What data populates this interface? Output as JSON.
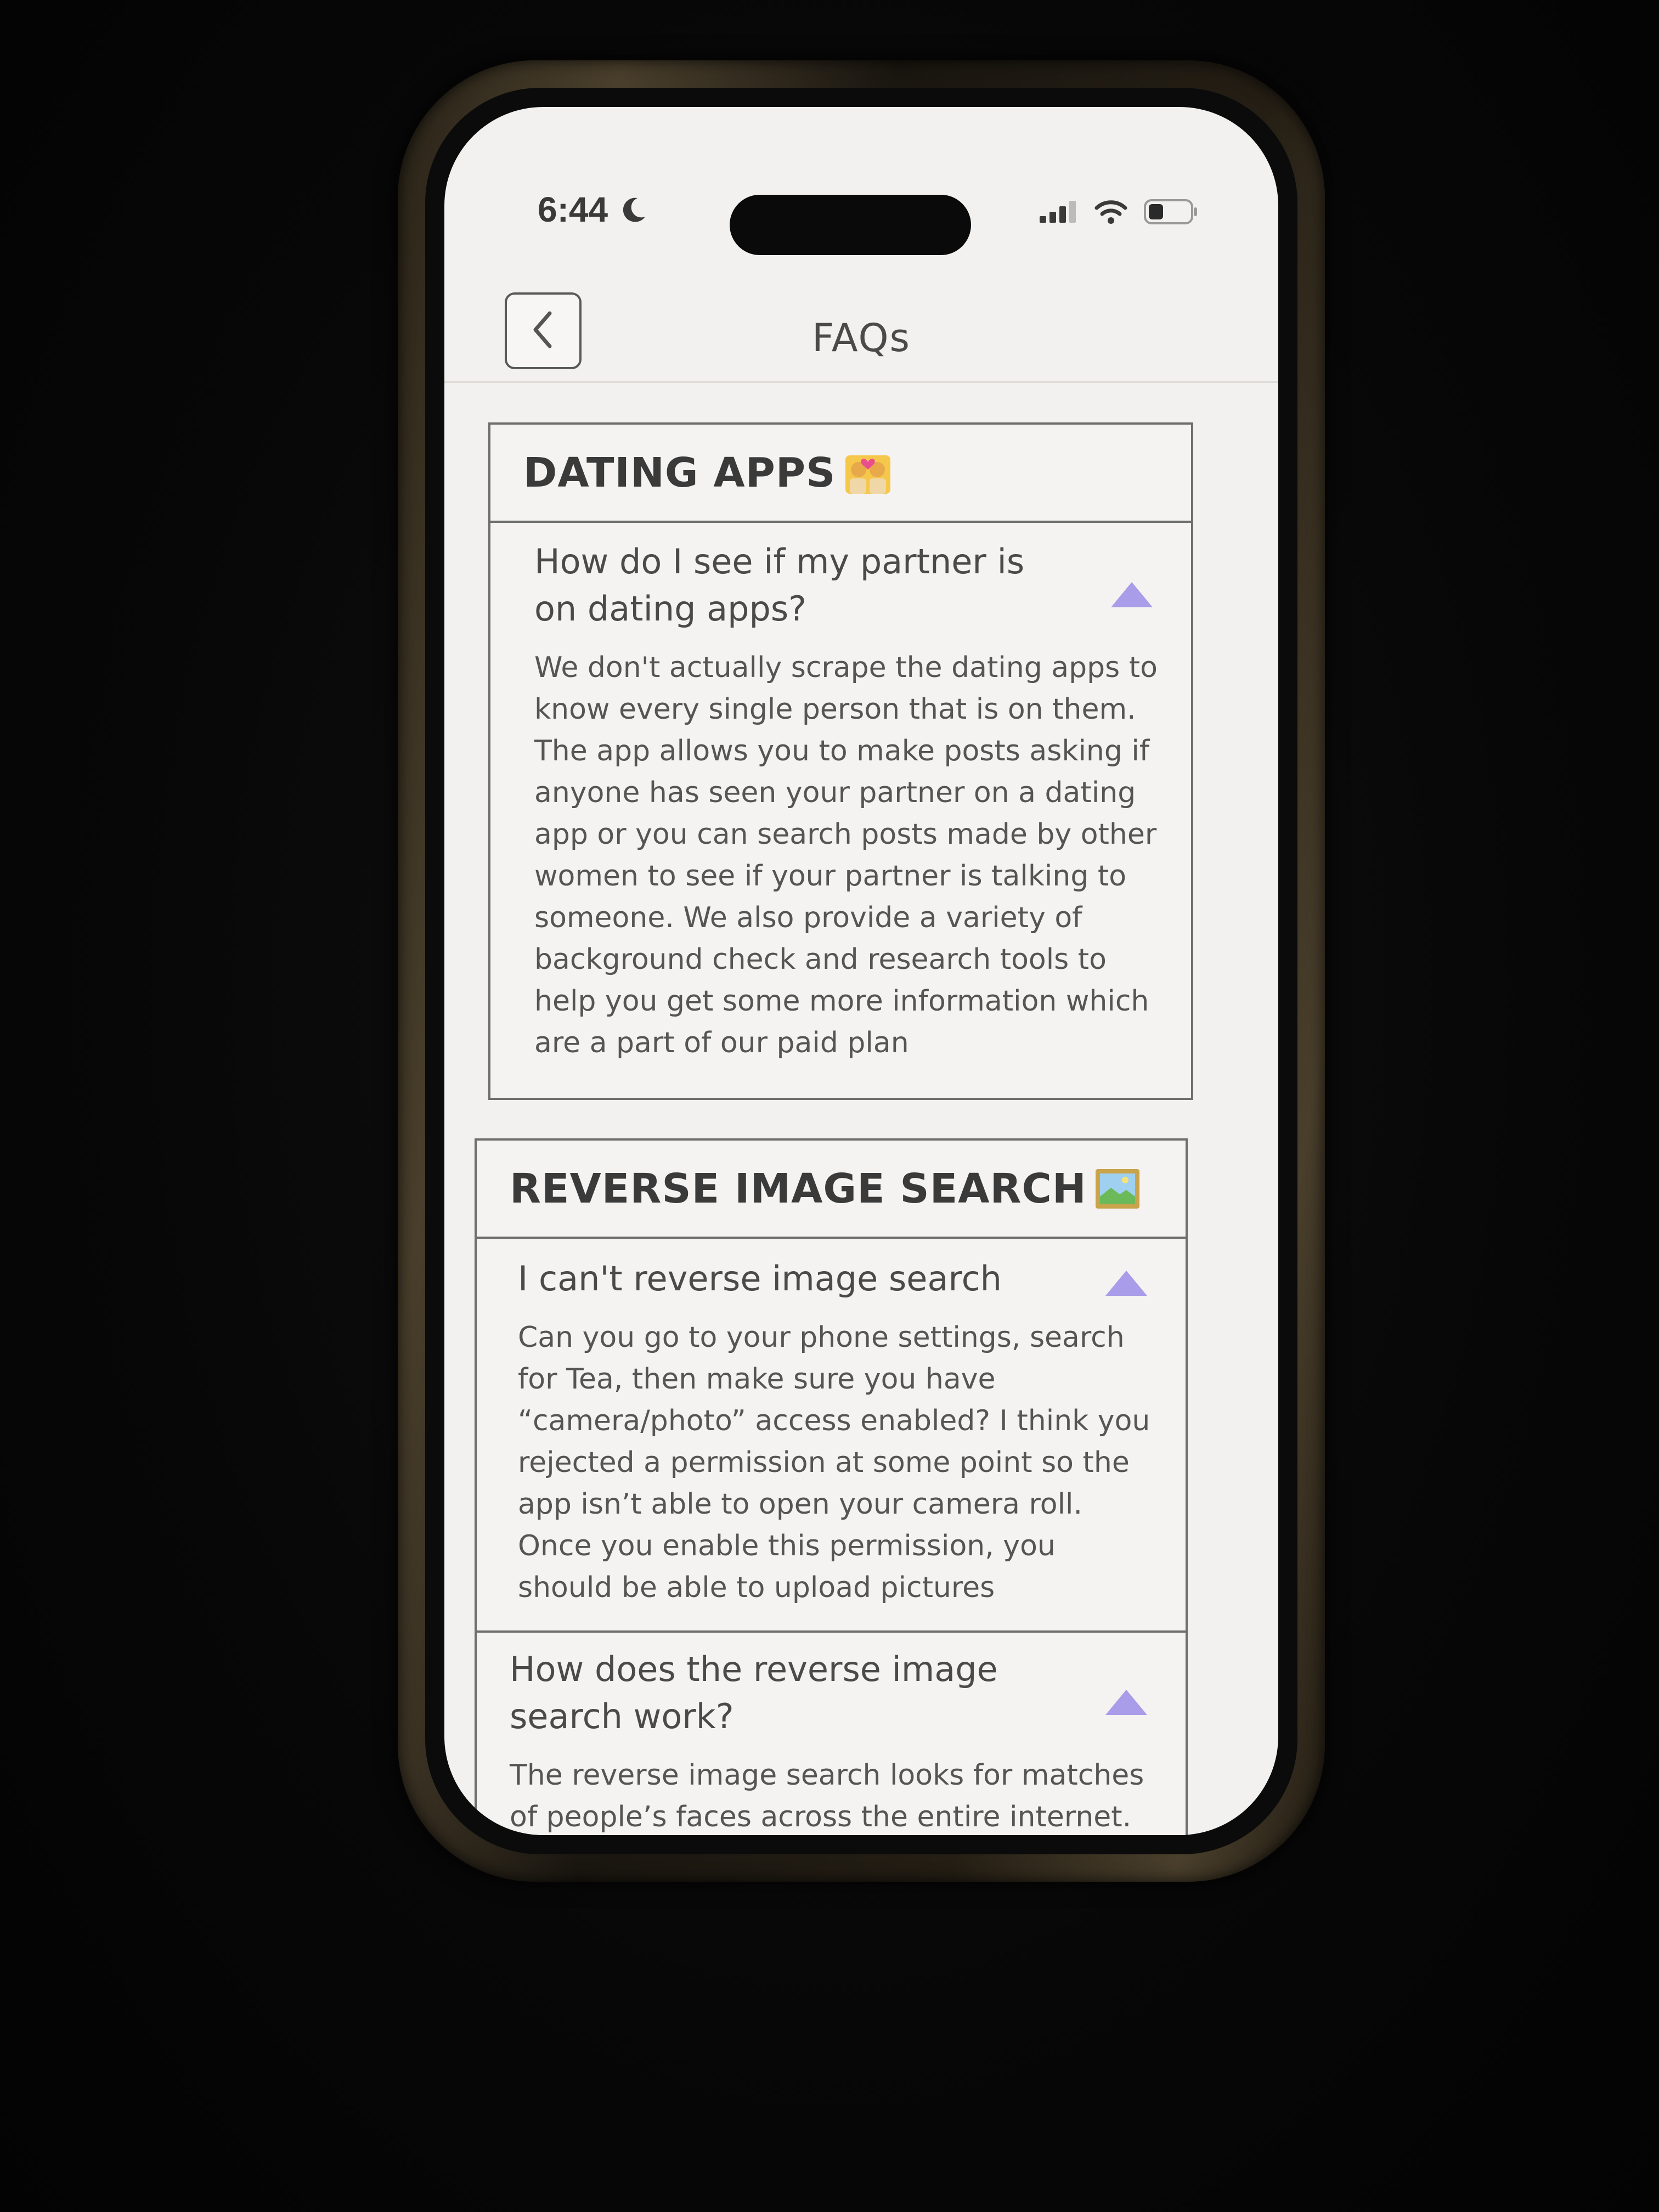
{
  "status_bar": {
    "time": "6:44",
    "icons": [
      "moon-icon",
      "signal-icon",
      "wifi-icon",
      "battery-icon"
    ]
  },
  "header": {
    "title": "FAQs",
    "back_icon": "chevron-left-icon"
  },
  "colors": {
    "accent": "#a99ce9",
    "screen_bg": "#f2f1ef",
    "text": "#4a4a4a",
    "border": "#6e6e6e"
  },
  "sections": [
    {
      "title": "DATING APPS",
      "emoji_icon": "couple-with-heart-icon",
      "items": [
        {
          "question": "How do I see if my partner is on dating apps?",
          "answer": "We don't actually scrape the dating apps to know every single person that is on them. The app allows you to make posts asking if anyone has seen your partner on a dating app or you can search posts made by other women to see if your partner is talking to someone. We also provide a variety of background check and research tools to help you get some more information which are a part of our paid plan",
          "expanded": true
        }
      ]
    },
    {
      "title": "REVERSE IMAGE SEARCH",
      "emoji_icon": "framed-picture-icon",
      "items": [
        {
          "question": "I can't reverse image search",
          "answer": "Can you go to your phone settings, search for Tea, then make sure you have “camera/photo” access enabled? I think you rejected a permission at some point so the app isn’t able to open your camera roll. Once you enable this permission, you should be able to upload pictures",
          "expanded": true
        },
        {
          "question": "How does the reverse image search work?",
          "answer": "The reverse image search looks for matches of people’s faces across the entire internet.",
          "expanded": true
        }
      ]
    }
  ]
}
